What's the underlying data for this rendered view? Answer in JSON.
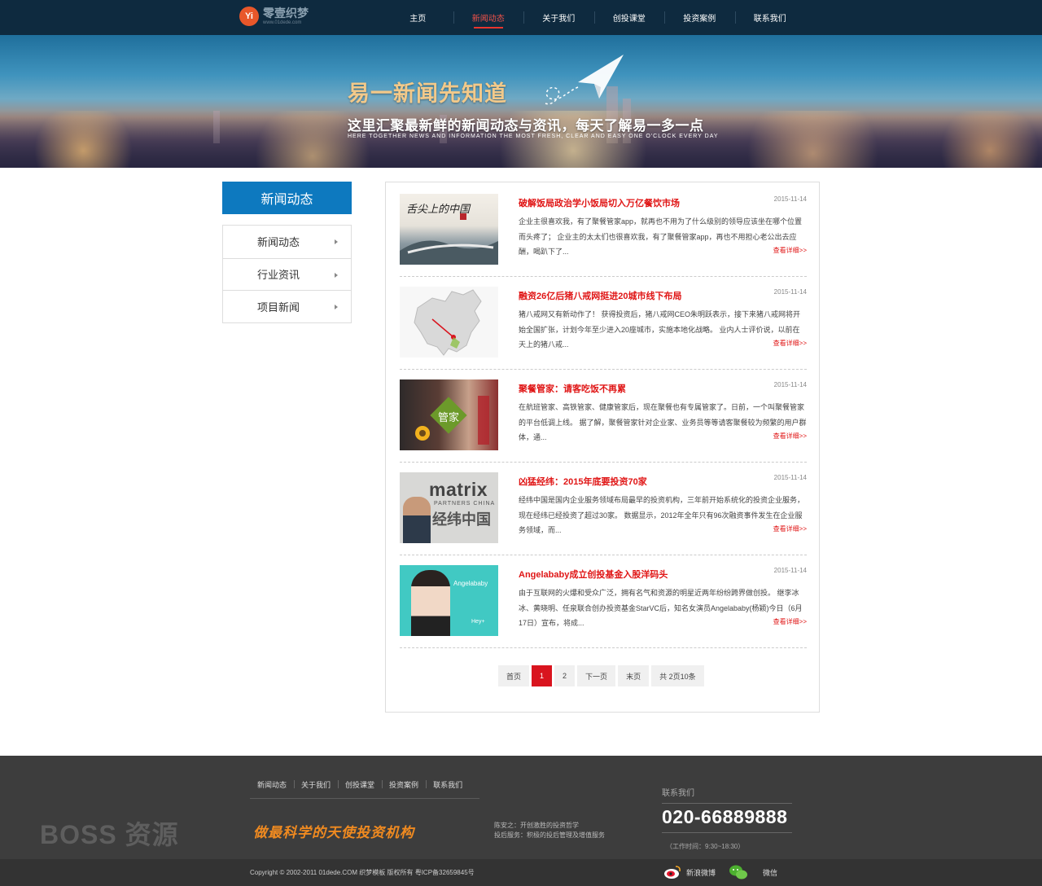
{
  "header": {
    "logo_name": "零壹织梦",
    "logo_url": "www.01dede.com",
    "logo_mark": "Yi",
    "nav": [
      "主页",
      "新闻动态",
      "关于我们",
      "创投课堂",
      "投资案例",
      "联系我们"
    ],
    "active_nav": "新闻动态"
  },
  "banner": {
    "title": "易一新闻先知道",
    "subtitle": "这里汇聚最新鲜的新闻动态与资讯，每天了解易一多一点",
    "english": "HERE TOGETHER NEWS AND INFORMATION THE MOST FRESH, CLEAR AND EASY ONE O'CLOCK EVERY DAY"
  },
  "sidebar": {
    "title": "新闻动态",
    "items": [
      "新闻动态",
      "行业资讯",
      "项目新闻"
    ]
  },
  "news": [
    {
      "title": "破解饭局政治学小饭局切入万亿餐饮市场",
      "date": "2015-11-14",
      "text": "企业主很喜欢我，有了聚餐管家app，就再也不用为了什么级别的领导应该坐在哪个位置而头疼了； 企业主的太太们也很喜欢我，有了聚餐管家app，再也不用担心老公出去应酬，喝趴下了...",
      "more": "查看详细>>",
      "thumb_caption": "舌尖上的中国"
    },
    {
      "title": "融资26亿后猪八戒网挺进20城市线下布局",
      "date": "2015-11-14",
      "text": "猪八戒网又有新动作了！ 获得投资后，猪八戒网CEO朱明跃表示，接下来猪八戒网将开始全国扩张，计划今年至少进入20座城市，实施本地化战略。 业内人士评价说，以前在天上的猪八戒...",
      "more": "查看详细>>",
      "thumb_caption": ""
    },
    {
      "title": "聚餐管家：请客吃饭不再累",
      "date": "2015-11-14",
      "text": "在航班管家、高铁管家、健康管家后，现在聚餐也有专属管家了。日前，一个叫聚餐管家的平台低调上线。 据了解，聚餐管家针对企业家、业务员等等请客聚餐较为频繁的用户群体，通...",
      "more": "查看详细>>",
      "thumb_caption": "管家"
    },
    {
      "title": "凶猛经纬：2015年底要投资70家",
      "date": "2015-11-14",
      "text": "经纬中国是国内企业服务领域布局最早的投资机构，三年前开始系统化的投资企业服务，现在经纬已经投资了超过30家。 数据显示，2012年全年只有96次融资事件发生在企业服务领域，而...",
      "more": "查看详细>>",
      "thumb_caption": "matrix"
    },
    {
      "title": "Angelababy成立创投基金入股洋码头",
      "date": "2015-11-14",
      "text": "由于互联网的火爆和受众广泛，拥有名气和资源的明星近两年纷纷跨界做创投。 继李冰冰、黄晓明、任泉联合创办投资基金StarVC后，知名女演员Angelababy(杨颖)今日（6月17日）宣布，将成...",
      "more": "查看详细>>",
      "thumb_caption": "Angelababy"
    }
  ],
  "thumb_texts": {
    "matrix_sub": "PARTNERS CHINA",
    "matrix_cn": "经纬中国",
    "angela_sub": "Hey+"
  },
  "pager": {
    "first": "首页",
    "pages": [
      "1",
      "2"
    ],
    "active": "1",
    "next": "下一页",
    "last": "末页",
    "info": "共 2页10条"
  },
  "footer": {
    "nav": [
      "新闻动态",
      "关于我们",
      "创投课堂",
      "投资案例",
      "联系我们"
    ],
    "slogan": "做最科学的天使投资机构",
    "info_line1": "陈安之：开创激胜的投资哲学",
    "info_line2": "投后服务：积极的投后管理及增值服务",
    "contact_label": "联系我们",
    "phone": "020-66889888",
    "hours": "（工作时间：9:30~18:30）",
    "copyright": "Copyright © 2002-2011 01dede.COM 织梦模板 版权所有 粤ICP备32659845号",
    "weibo": "新浪微博",
    "wechat": "微信",
    "watermark": "BOSS 资源"
  },
  "colors": {
    "topbar": "#0e2a3f",
    "accent_red": "#e01515",
    "sidebar_blue": "#0d79bf",
    "footer_bg": "#3d3d3d",
    "slogan_orange": "#f08a20"
  }
}
